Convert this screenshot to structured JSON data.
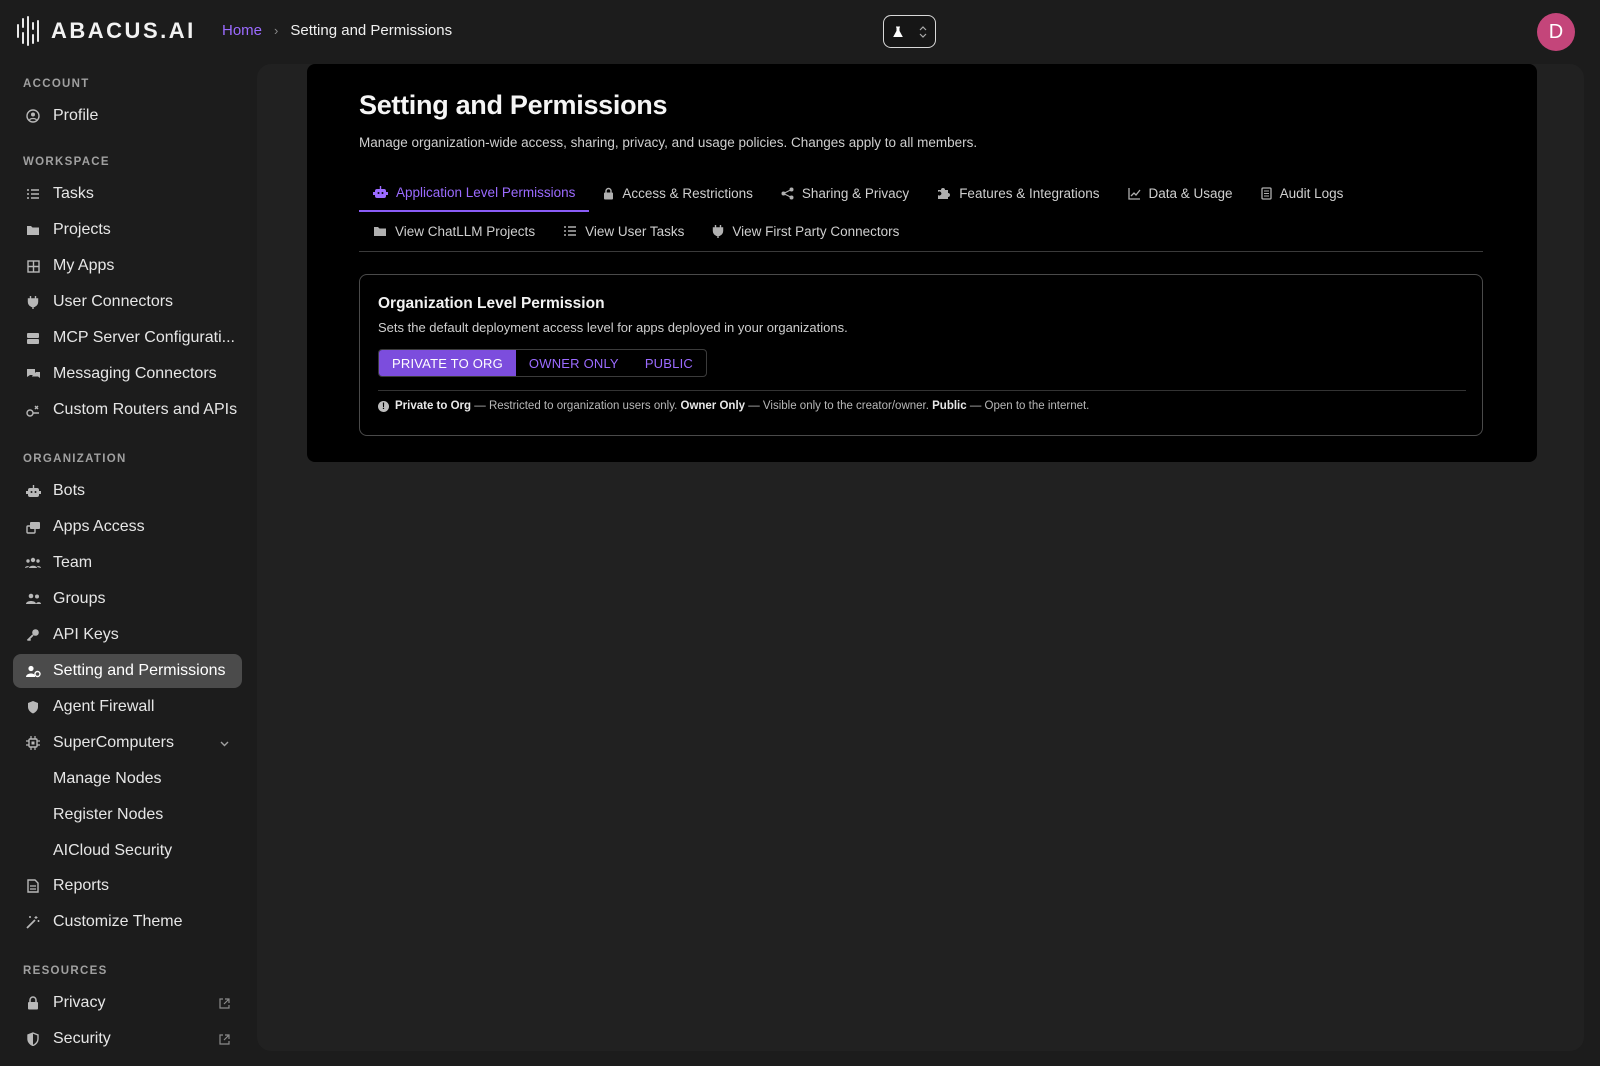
{
  "brand": {
    "name": "ABACUS.AI"
  },
  "breadcrumb": {
    "home": "Home",
    "separator": "›",
    "current": "Setting and Permissions"
  },
  "header": {
    "avatar_initial": "D",
    "mode_icon": "flask-icon"
  },
  "sidebar": {
    "sections": {
      "account": "ACCOUNT",
      "workspace": "WORKSPACE",
      "organization": "ORGANIZATION",
      "resources": "RESOURCES"
    },
    "items": {
      "profile": "Profile",
      "tasks": "Tasks",
      "projects": "Projects",
      "my_apps": "My Apps",
      "user_connectors": "User Connectors",
      "mcp": "MCP Server Configurati...",
      "messaging": "Messaging Connectors",
      "routers": "Custom Routers and APIs",
      "bots": "Bots",
      "apps_access": "Apps Access",
      "team": "Team",
      "groups": "Groups",
      "api_keys": "API Keys",
      "settings": "Setting and Permissions",
      "firewall": "Agent Firewall",
      "supercomputers": "SuperComputers",
      "manage_nodes": "Manage Nodes",
      "register_nodes": "Register Nodes",
      "aicloud": "AICloud Security",
      "reports": "Reports",
      "theme": "Customize Theme",
      "privacy": "Privacy",
      "security": "Security"
    }
  },
  "main": {
    "title": "Setting and Permissions",
    "subtitle": "Manage organization-wide access, sharing, privacy, and usage policies. Changes apply to all members.",
    "tabs": [
      {
        "label": "Application Level Permissions",
        "icon": "robot-icon",
        "active": true
      },
      {
        "label": "Access & Restrictions",
        "icon": "lock-icon"
      },
      {
        "label": "Sharing & Privacy",
        "icon": "share-icon"
      },
      {
        "label": "Features & Integrations",
        "icon": "puzzle-icon"
      },
      {
        "label": "Data & Usage",
        "icon": "chart-icon"
      },
      {
        "label": "Audit Logs",
        "icon": "log-icon"
      },
      {
        "label": "View ChatLLM Projects",
        "icon": "folder-icon"
      },
      {
        "label": "View User Tasks",
        "icon": "list-icon"
      },
      {
        "label": "View First Party Connectors",
        "icon": "plug-icon"
      }
    ],
    "permission": {
      "title": "Organization Level Permission",
      "subtitle": "Sets the default deployment access level for apps deployed in your organizations.",
      "options": [
        "PRIVATE TO ORG",
        "OWNER ONLY",
        "PUBLIC"
      ],
      "selected": "PRIVATE TO ORG",
      "note": {
        "t1": "Private to Org",
        "d1": " — Restricted to organization users only. ",
        "t2": "Owner Only",
        "d2": " — Visible only to the creator/owner. ",
        "t3": "Public",
        "d3": " — Open to the internet."
      }
    }
  },
  "colors": {
    "accent": "#8a5cf6",
    "avatar": "#c4457a",
    "active_nav": "#4b4b4b"
  }
}
